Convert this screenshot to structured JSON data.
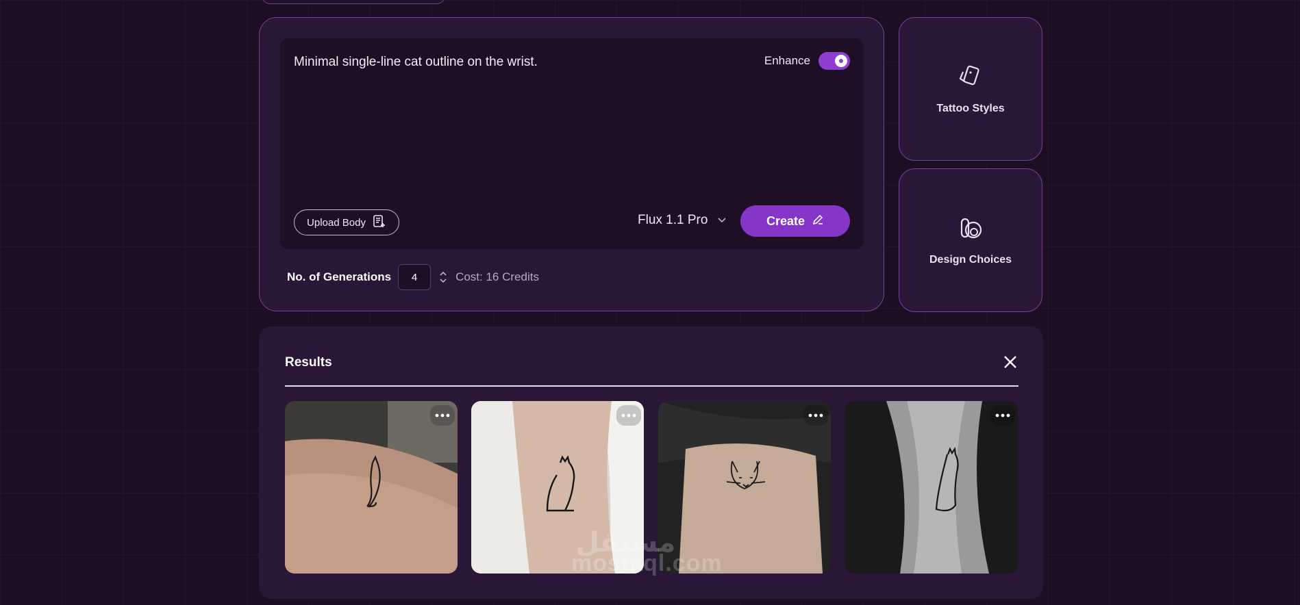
{
  "prompt": {
    "text": "Minimal single-line cat outline on the wrist.",
    "enhance_label": "Enhance",
    "enhance_on": true,
    "upload_label": "Upload Body",
    "model": "Flux 1.1 Pro",
    "create_label": "Create"
  },
  "generations": {
    "label": "No. of Generations",
    "value": "4",
    "cost": "Cost: 16 Credits"
  },
  "side_cards": [
    {
      "label": "Tattoo Styles",
      "icon": "cards-icon"
    },
    {
      "label": "Design Choices",
      "icon": "design-icon"
    }
  ],
  "results": {
    "title": "Results",
    "items": [
      {
        "alt": "cat tattoo 1",
        "icon": "more-icon"
      },
      {
        "alt": "cat tattoo 2",
        "icon": "more-icon"
      },
      {
        "alt": "cat tattoo 3",
        "icon": "more-icon"
      },
      {
        "alt": "cat tattoo 4",
        "icon": "more-icon"
      }
    ]
  },
  "watermark": {
    "arabic": "مستقل",
    "latin": "mostaql.com"
  },
  "colors": {
    "background": "#1c0f23",
    "panel": "#2a1636",
    "accent": "#8535c7",
    "border": "#7a3f9e"
  }
}
